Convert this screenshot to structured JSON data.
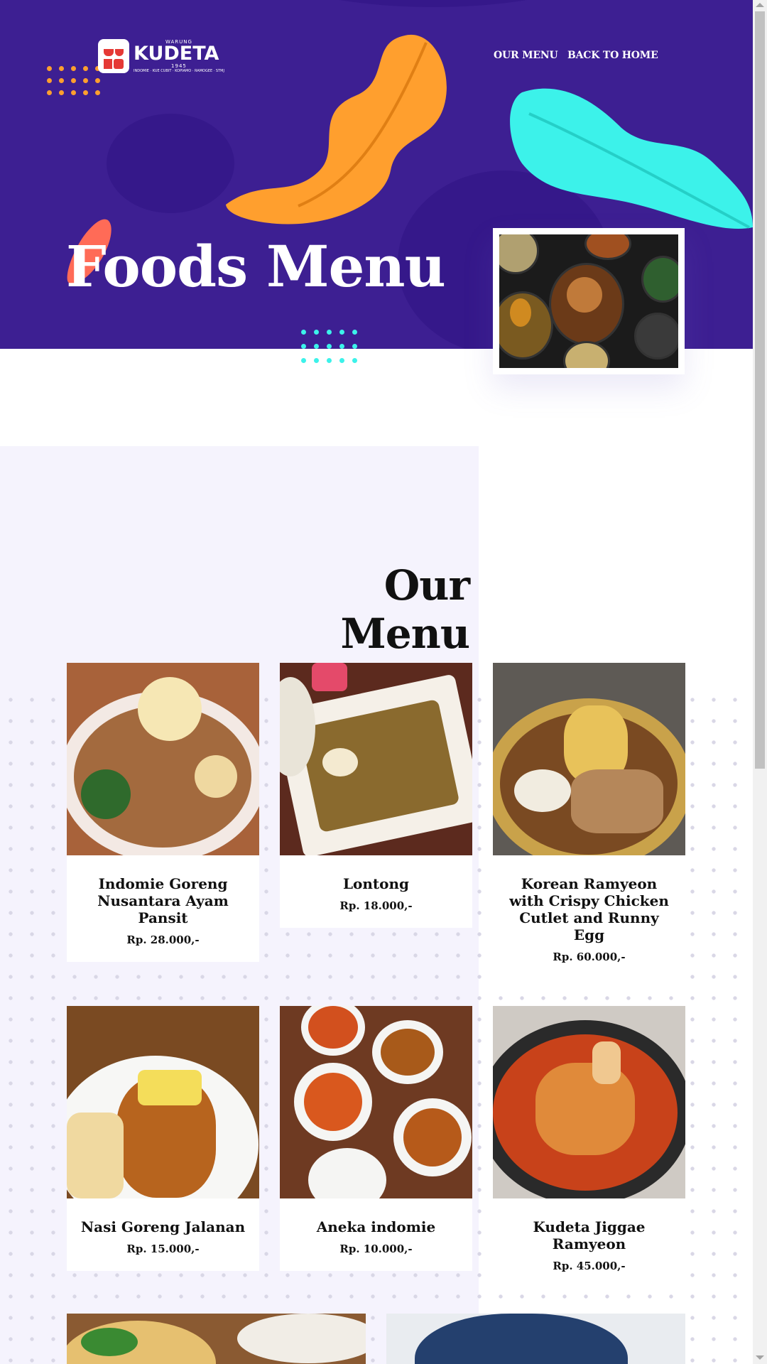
{
  "header": {
    "logo_small": "WARUNG",
    "logo_name": "KUDETA",
    "logo_year": "1945",
    "logo_tagline": "INDOMIE · KUE CUBIT · KOPIAMO · RAMOGEE · STMJ",
    "nav": [
      "OUR MENU",
      "BACK TO HOME"
    ],
    "title": "Foods Menu"
  },
  "menu": {
    "title": "Our Menu",
    "items": [
      {
        "name": "Indomie Goreng Nusantara Ayam Pansit",
        "price": "Rp. 28.000,-"
      },
      {
        "name": "Lontong",
        "price": "Rp. 18.000,-"
      },
      {
        "name": "Korean Ramyeon with Crispy Chicken Cutlet and Runny Egg",
        "price": "Rp. 60.000,-"
      },
      {
        "name": "Nasi Goreng Jalanan",
        "price": "Rp. 15.000,-"
      },
      {
        "name": "Aneka indomie",
        "price": "Rp. 10.000,-"
      },
      {
        "name": "Kudeta Jiggae Ramyeon",
        "price": "Rp. 45.000,-"
      }
    ]
  },
  "colors": {
    "hero_bg": "#3d1f92",
    "accent_orange": "#ff9f2e",
    "accent_cyan": "#3cf2ea",
    "accent_coral": "#ff6b57",
    "section_bg": "#f5f3fd"
  }
}
